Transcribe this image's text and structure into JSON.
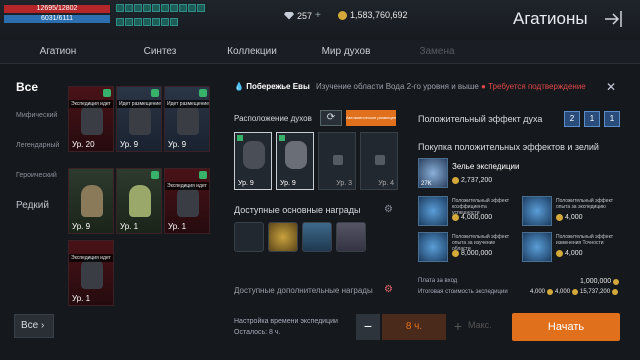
{
  "topbar": {
    "hp": "12695/12802",
    "mp": "6031/6111",
    "diamond_amount": "257",
    "gold_amount": "1,583,760,692",
    "page_title": "Агатионы"
  },
  "tabs": [
    {
      "label": "Агатион"
    },
    {
      "label": "Синтез"
    },
    {
      "label": "Коллекции"
    },
    {
      "label": "Мир духов"
    },
    {
      "label": "Замена"
    }
  ],
  "filters": {
    "all": "Все",
    "mythic": "Мифический",
    "legendary": "Легендарный",
    "heroic": "Героический",
    "rare": "Редкий",
    "bottom_all": "Все"
  },
  "agathions": [
    {
      "tag": "Экспедиция идет",
      "level": "Ур. 20"
    },
    {
      "tag": "Идет размещение...",
      "level": "Ур. 9"
    },
    {
      "tag": "Идет размещение...",
      "level": "Ур. 9"
    },
    {
      "tag": "",
      "level": "Ур. 9"
    },
    {
      "tag": "",
      "level": "Ур. 1"
    },
    {
      "tag": "Экспедиция идет",
      "level": "Ур. 1"
    },
    {
      "tag": "Экспедиция идет",
      "level": "Ур. 1"
    }
  ],
  "expedition": {
    "location": "Побережье Евы",
    "condition": "Изучение области Вода 2-го уровня и выше",
    "requirement": "Требуется подтверждение",
    "spirit_placement": "Расположение духов",
    "auto_place": "Автоматическое размещение",
    "spirit_slots": [
      {
        "level": "Ур. 9"
      },
      {
        "level": "Ур. 9"
      },
      {
        "level": "Ур. 3"
      },
      {
        "level": "Ур. 4"
      }
    ],
    "rewards_title": "Доступные основные награды",
    "extra_rewards_title": "Доступные дополнительные награды",
    "time_setting": "Настройка времени экспедиции",
    "time_left": "Осталось: 8 ч.",
    "time_value": "8 ч.",
    "max_label": "Макс.",
    "start_label": "Начать"
  },
  "effects": {
    "title": "Положительный эффект духа",
    "counters": [
      "2",
      "1",
      "1"
    ],
    "purchase_title": "Покупка положительных эффектов и зелий",
    "potion_name": "Зелье экспедиции",
    "potion_count": "27K",
    "potion_price": "2,737,200",
    "items": [
      {
        "desc": "Положительный эффект коэффициента успешности",
        "price": "4,000,000"
      },
      {
        "desc": "Положительный эффект опыта за экспедицию",
        "price": "4,000"
      },
      {
        "desc": "Положительный эффект опыта за изучение области",
        "price": "8,000,000"
      },
      {
        "desc": "Положительный эффект изменения Точности",
        "price": "4,000"
      }
    ],
    "entry_fee_label": "Плата за вход",
    "entry_fee": "1,000,000",
    "total_label": "Итоговая стоимость экспедиции",
    "total_a": "4,000",
    "total_b": "4,000",
    "total_c": "15,737,200"
  },
  "colors": {
    "accent": "#e0701c",
    "hp": "#b3262a",
    "mp": "#2c6fb0",
    "warning": "#e04848"
  }
}
